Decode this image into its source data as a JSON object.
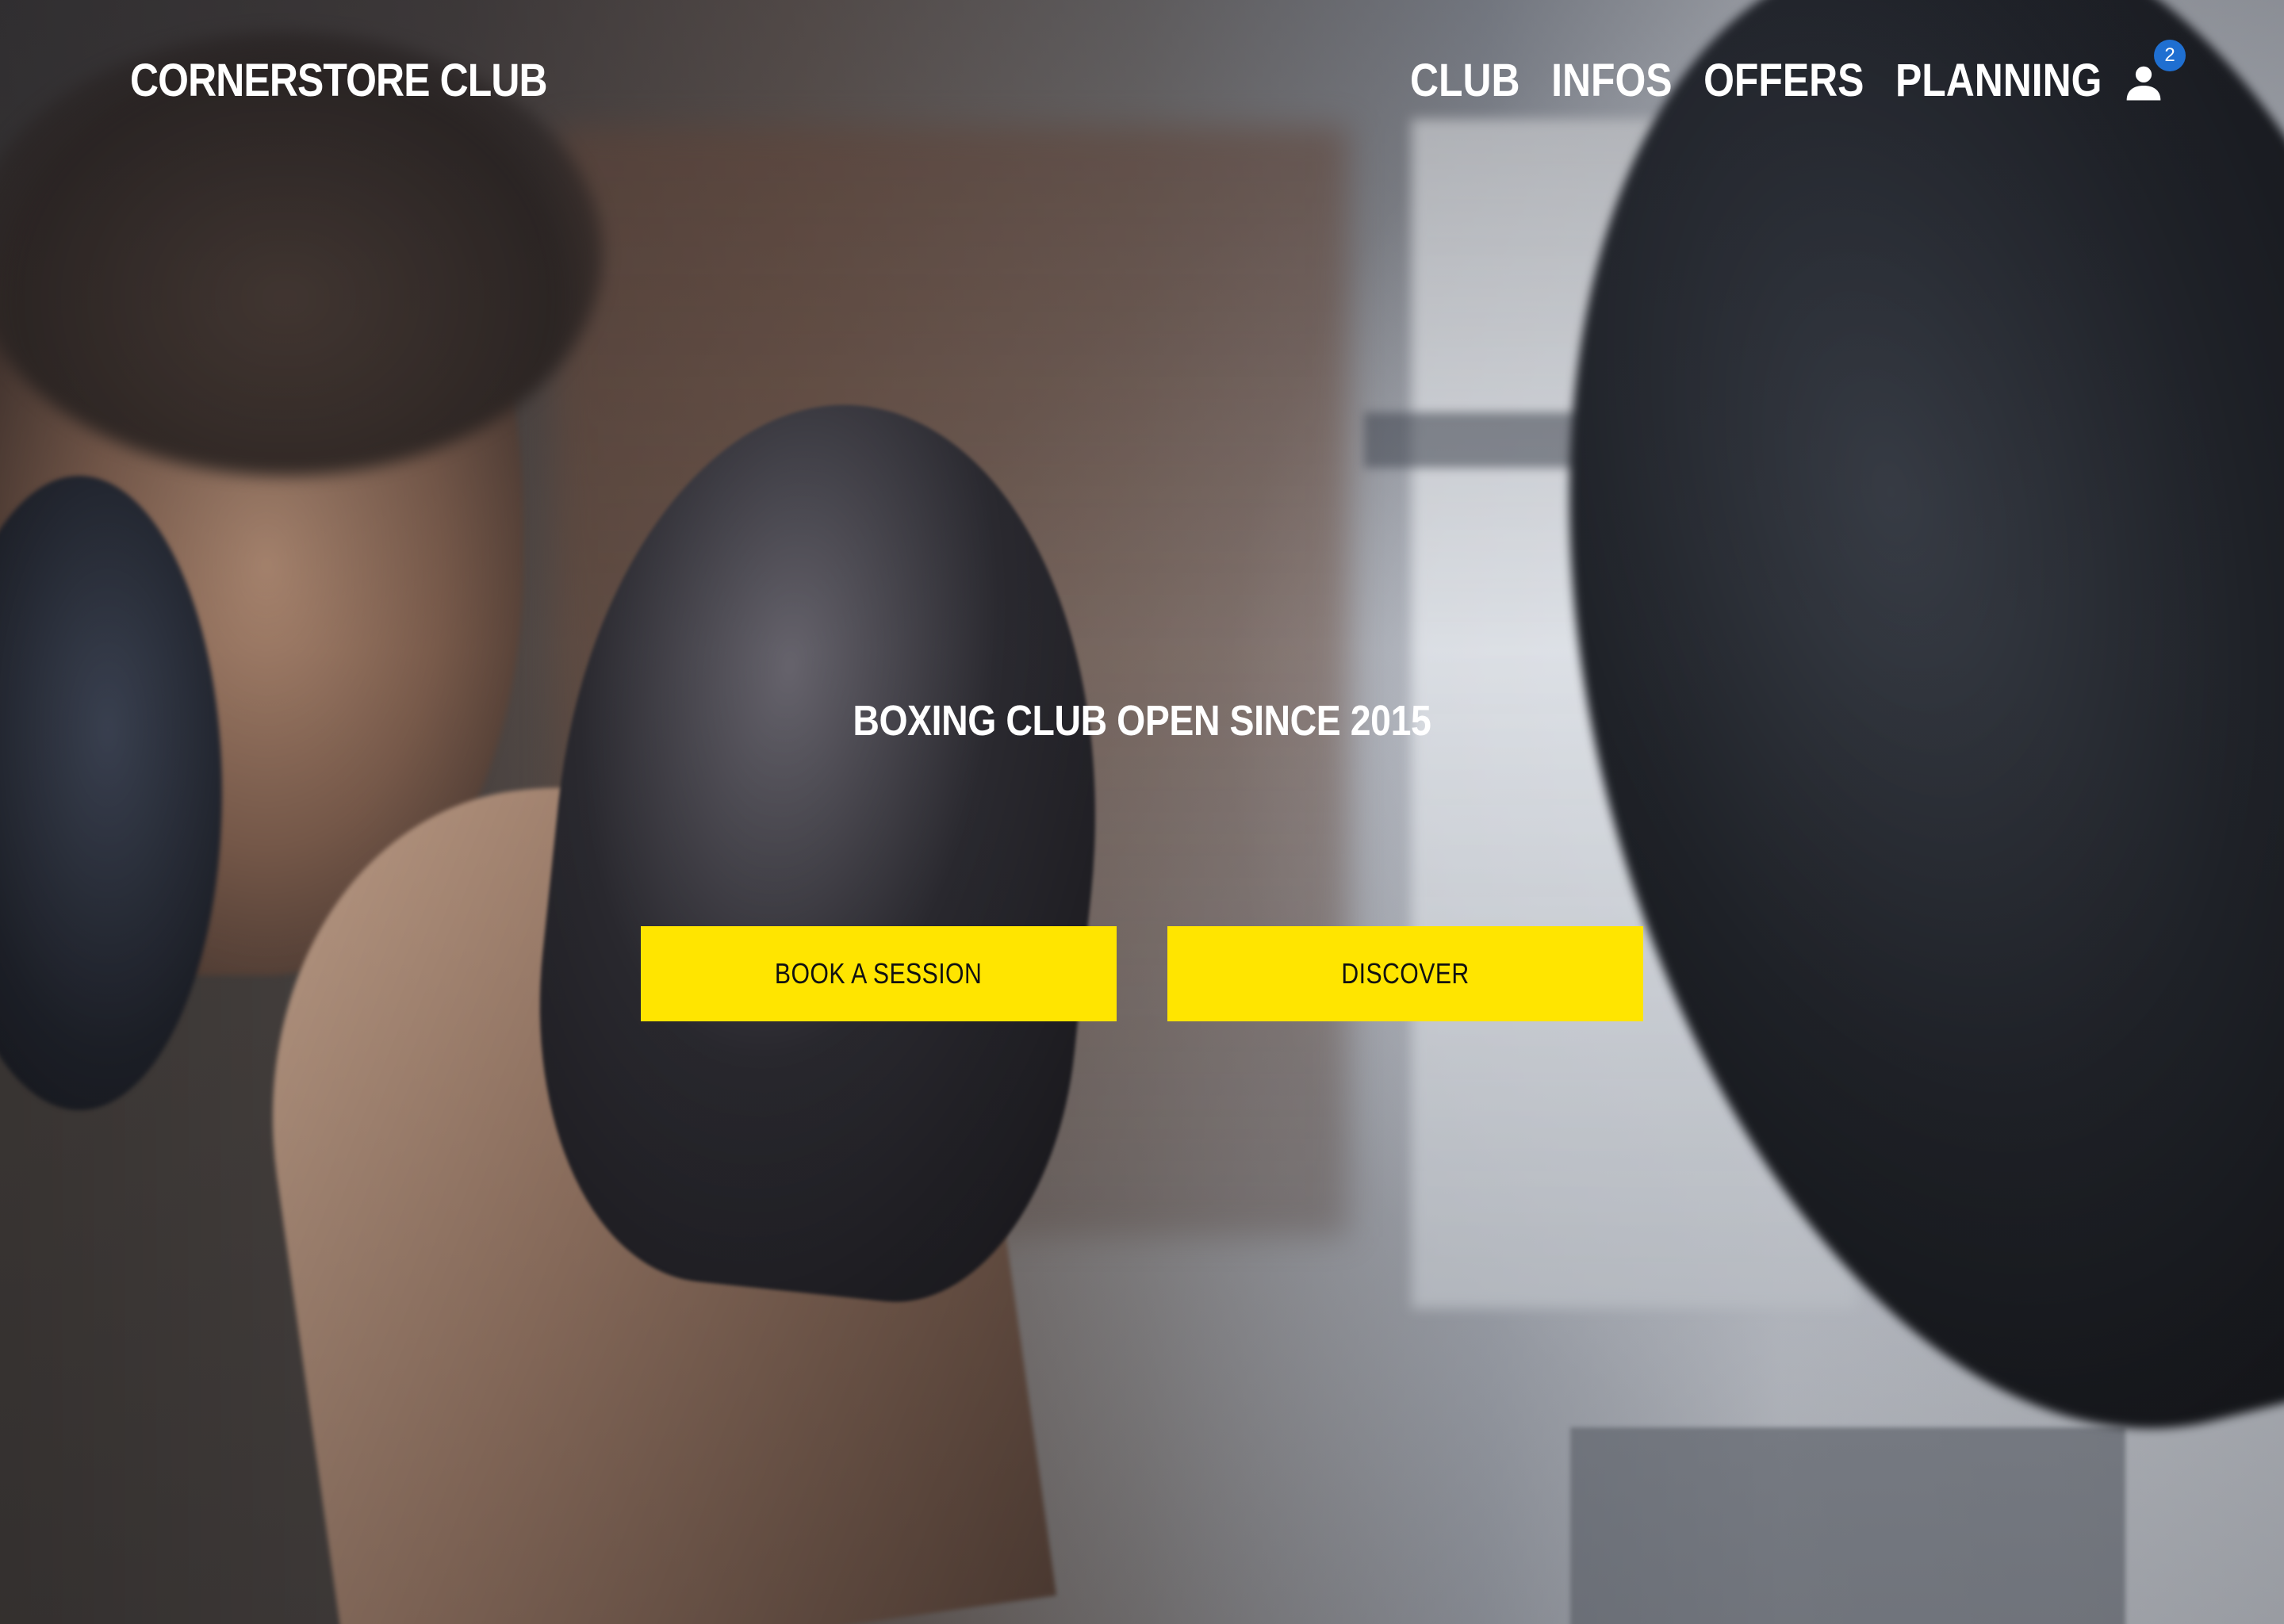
{
  "header": {
    "logo": "CORNERSTORE CLUB",
    "nav": [
      {
        "label": "CLUB"
      },
      {
        "label": "INFOS"
      },
      {
        "label": "OFFERS"
      },
      {
        "label": "PLANNING"
      }
    ],
    "account": {
      "icon": "user-icon",
      "badge_count": "2"
    }
  },
  "hero": {
    "title": "BOXING CLUB OPEN SINCE 2015",
    "buttons": [
      {
        "label": "BOOK A SESSION"
      },
      {
        "label": "DISCOVER"
      }
    ]
  },
  "colors": {
    "accent": "#ffe500",
    "badge": "#1f6fd1",
    "text": "#ffffff"
  }
}
